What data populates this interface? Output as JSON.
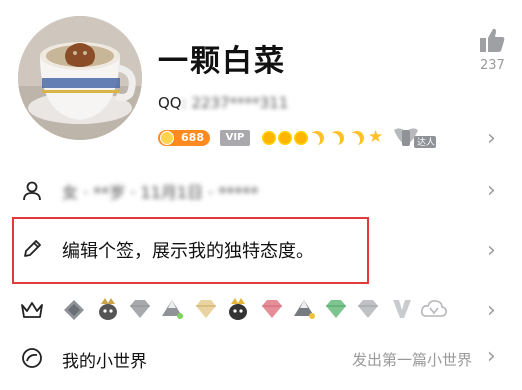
{
  "profile": {
    "name": "一颗白菜",
    "qq_prefix": "QQ",
    "qq_masked": ": 2237****311",
    "like_count": "237",
    "level_badge": "688",
    "vip_label": "VIP",
    "daren_label": "达人"
  },
  "rows": {
    "info_masked": "女 · **岁 · 11月1日 · *****",
    "signature": "编辑个签，展示我的独特态度。",
    "world_label": "我的小世界",
    "world_action": "发出第一篇小世界"
  },
  "colors": {
    "accent_red": "#e03a3a",
    "level_orange": "#ff8a1f",
    "gold": "#ffc12a",
    "chevron_gray": "#9e9e9e"
  }
}
